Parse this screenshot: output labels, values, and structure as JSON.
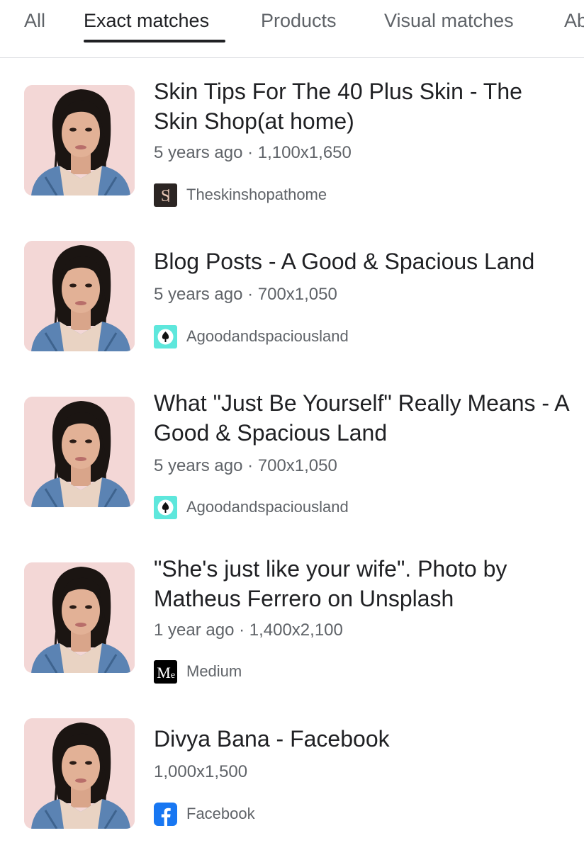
{
  "tabs": [
    {
      "label": "All"
    },
    {
      "label": "Exact matches"
    },
    {
      "label": "Products"
    },
    {
      "label": "Visual matches"
    },
    {
      "label": "Ab"
    }
  ],
  "active_tab": "Exact matches",
  "results": [
    {
      "title": "Skin Tips For The 40 Plus Skin - The Skin Shop(at home)",
      "meta": "5 years ago · 1,100x1,650",
      "source": "Theskinshopathome",
      "favicon": "skinshop-s-logo"
    },
    {
      "title": "Blog Posts - A Good & Spacious Land",
      "meta": "5 years ago · 700x1,050",
      "source": "Agoodandspaciousland",
      "favicon": "spade-tree-logo"
    },
    {
      "title": "What \"Just Be Yourself\" Really Means - A Good & Spacious Land",
      "meta": "5 years ago · 700x1,050",
      "source": "Agoodandspaciousland",
      "favicon": "spade-tree-logo"
    },
    {
      "title": "\"She's just like your wife\". Photo by Matheus Ferrero on Unsplash",
      "meta": "1 year ago · 1,400x2,100",
      "source": "Medium",
      "favicon": "medium-m-logo"
    },
    {
      "title": "Divya Bana - Facebook",
      "meta": "1,000x1,500",
      "source": "Facebook",
      "favicon": "facebook-f-logo"
    }
  ],
  "colors": {
    "accent": "#202124",
    "muted": "#5f6368",
    "thumb_bg": "#f3d7d6",
    "facebook": "#1877f2",
    "spacious_land": "#5ee7dc"
  }
}
